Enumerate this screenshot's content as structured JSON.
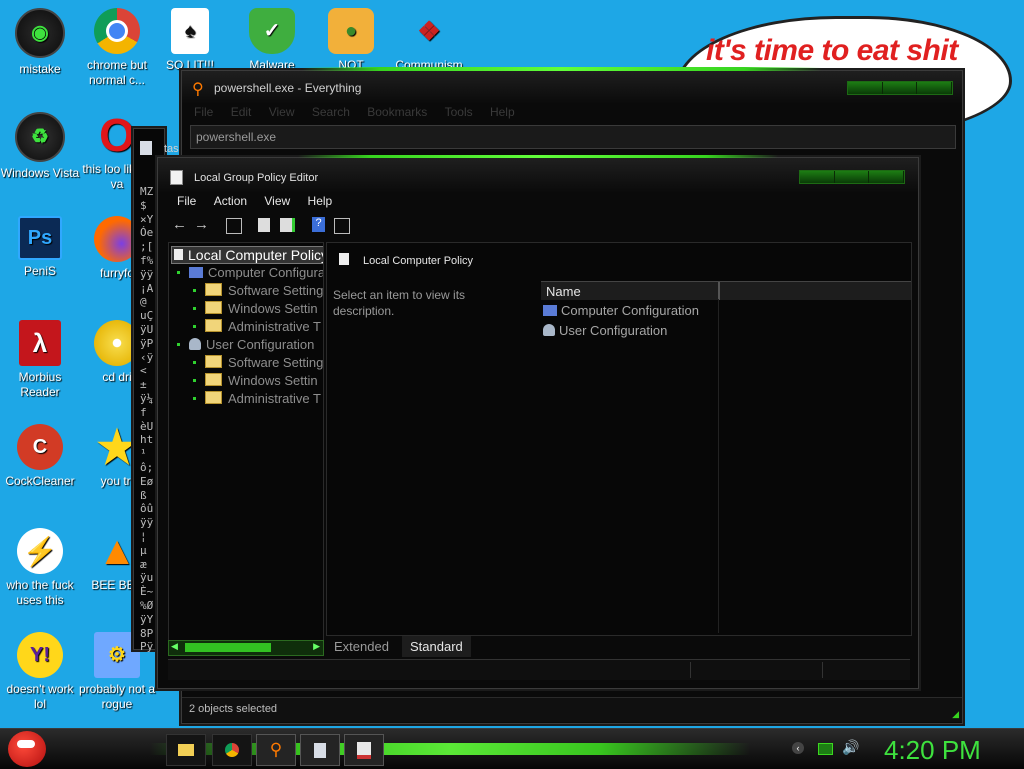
{
  "desktop_icons": [
    {
      "label": "mistake"
    },
    {
      "label": "chrome but normal c..."
    },
    {
      "label": "SO LIT!!!"
    },
    {
      "label": "Malware"
    },
    {
      "label": "NOT"
    },
    {
      "label": "Communism"
    },
    {
      "label": "Windows Vista"
    },
    {
      "label": "this loo like a va"
    },
    {
      "label": "PeniS"
    },
    {
      "label": "furryfo"
    },
    {
      "label": "Morbius Reader"
    },
    {
      "label": "cd dri"
    },
    {
      "label": "CockCleaner"
    },
    {
      "label": "you tri"
    },
    {
      "label": "who the fuck uses this"
    },
    {
      "label": "BEE BEE"
    },
    {
      "label": "doesn't work lol"
    },
    {
      "label": "probably not a rogue"
    }
  ],
  "bubble_text": "it's time to eat shit",
  "everything_window": {
    "title": "powershell.exe - Everything",
    "menu": [
      "File",
      "Edit",
      "View",
      "Search",
      "Bookmarks",
      "Tools",
      "Help"
    ],
    "search_value": "powershell.exe",
    "status": "2 objects selected"
  },
  "terminal_window": {
    "title": "tas",
    "glyphs": [
      "MZ",
      "$",
      "×Y",
      "Óe",
      ";[",
      "f%",
      "ÿÿ",
      "¡A",
      "@",
      "uÇ",
      "ÿU",
      "ÿP",
      "‹ÿ",
      "<",
      "±",
      "ÿ¼",
      "f",
      "èU",
      "ht",
      "¹",
      "ô;",
      "Eø",
      "ß",
      "ôû",
      "ÿÿ",
      "¦",
      "µ",
      "æ",
      "ÿu",
      "È~",
      "%Ø",
      "ÿY",
      "8P",
      "Pÿ"
    ]
  },
  "gpedit_window": {
    "title": "Local Group Policy Editor",
    "menu": [
      "File",
      "Action",
      "View",
      "Help"
    ],
    "tree": {
      "root": "Local Computer Policy",
      "computer": "Computer Configurati",
      "user": "User Configuration",
      "computer_children": [
        "Software Settings",
        "Windows Settin",
        "Administrative T"
      ],
      "user_children": [
        "Software Settings",
        "Windows Settin",
        "Administrative T"
      ]
    },
    "header": "Local Computer Policy",
    "description": "Select an item to view its description.",
    "list_header": "Name",
    "list_items": [
      "Computer Configuration",
      "User Configuration"
    ],
    "tabs": [
      "Extended",
      "Standard"
    ]
  },
  "taskbar": {
    "clock": "4:20 PM"
  },
  "colors": {
    "accent": "#37d41f",
    "desktop": "#1ea7e6",
    "bubble_text": "#e02020"
  }
}
